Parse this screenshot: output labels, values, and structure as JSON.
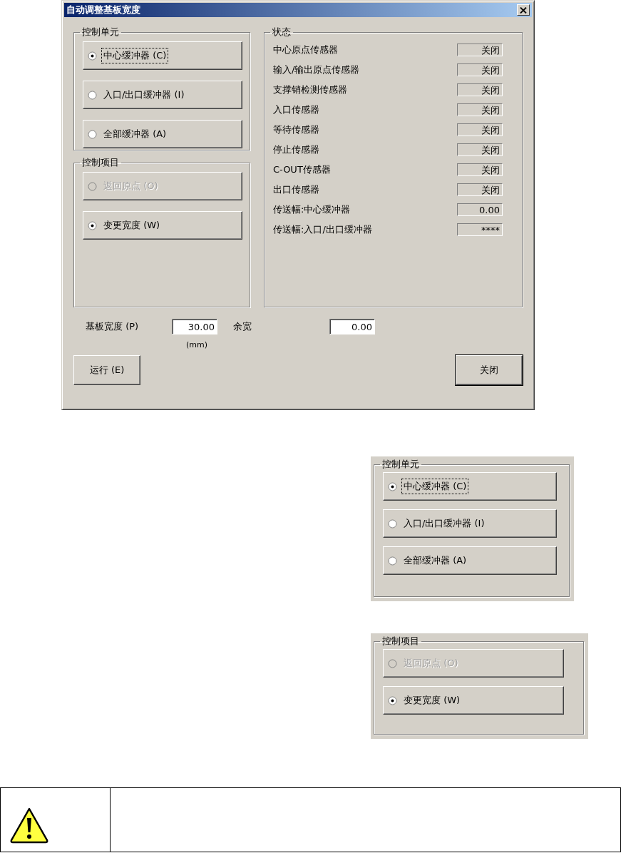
{
  "dialog": {
    "title": "自动调整基板宽度",
    "control_unit": {
      "label": "控制单元",
      "options": [
        {
          "label": "中心缓冲器 (C)",
          "selected": true,
          "focused": true,
          "disabled": false
        },
        {
          "label": "入口/出口缓冲器 (I)",
          "selected": false,
          "focused": false,
          "disabled": false
        },
        {
          "label": "全部缓冲器 (A)",
          "selected": false,
          "focused": false,
          "disabled": false
        }
      ]
    },
    "control_items": {
      "label": "控制项目",
      "options": [
        {
          "label": "返回原点 (O)",
          "selected": false,
          "focused": false,
          "disabled": true
        },
        {
          "label": "变更宽度 (W)",
          "selected": true,
          "focused": false,
          "disabled": false
        }
      ]
    },
    "status": {
      "label": "状态",
      "rows": [
        {
          "label": "中心原点传感器",
          "value": "关闭"
        },
        {
          "label": "输入/输出原点传感器",
          "value": "关闭"
        },
        {
          "label": "支撑销检测传感器",
          "value": "关闭"
        },
        {
          "label": "入口传感器",
          "value": "关闭"
        },
        {
          "label": "等待传感器",
          "value": "关闭"
        },
        {
          "label": "停止传感器",
          "value": "关闭"
        },
        {
          "label": "C-OUT传感器",
          "value": "关闭"
        },
        {
          "label": "出口传感器",
          "value": "关闭"
        },
        {
          "label": "传送幅:中心缓冲器",
          "value": "0.00"
        },
        {
          "label": "传送幅:入口/出口缓冲器",
          "value": "****"
        }
      ]
    },
    "board_width": {
      "label": "基板宽度 (P)",
      "value": "30.00",
      "unit": "(mm)"
    },
    "margin": {
      "label": "余宽",
      "value": "0.00"
    },
    "buttons": [
      {
        "label": "运行 (E)",
        "default": false
      },
      {
        "label": "关闭",
        "default": true
      }
    ]
  },
  "insets": [
    {
      "label": "控制单元",
      "options": [
        {
          "label": "中心缓冲器 (C)",
          "selected": true,
          "focused": true,
          "disabled": false
        },
        {
          "label": "入口/出口缓冲器 (I)",
          "selected": false,
          "focused": false,
          "disabled": false
        },
        {
          "label": "全部缓冲器 (A)",
          "selected": false,
          "focused": false,
          "disabled": false
        }
      ]
    },
    {
      "label": "控制项目",
      "options": [
        {
          "label": "返回原点 (O)",
          "selected": false,
          "focused": false,
          "disabled": true
        },
        {
          "label": "变更宽度 (W)",
          "selected": true,
          "focused": false,
          "disabled": false
        }
      ]
    }
  ],
  "warning": {
    "kind": "caution"
  }
}
